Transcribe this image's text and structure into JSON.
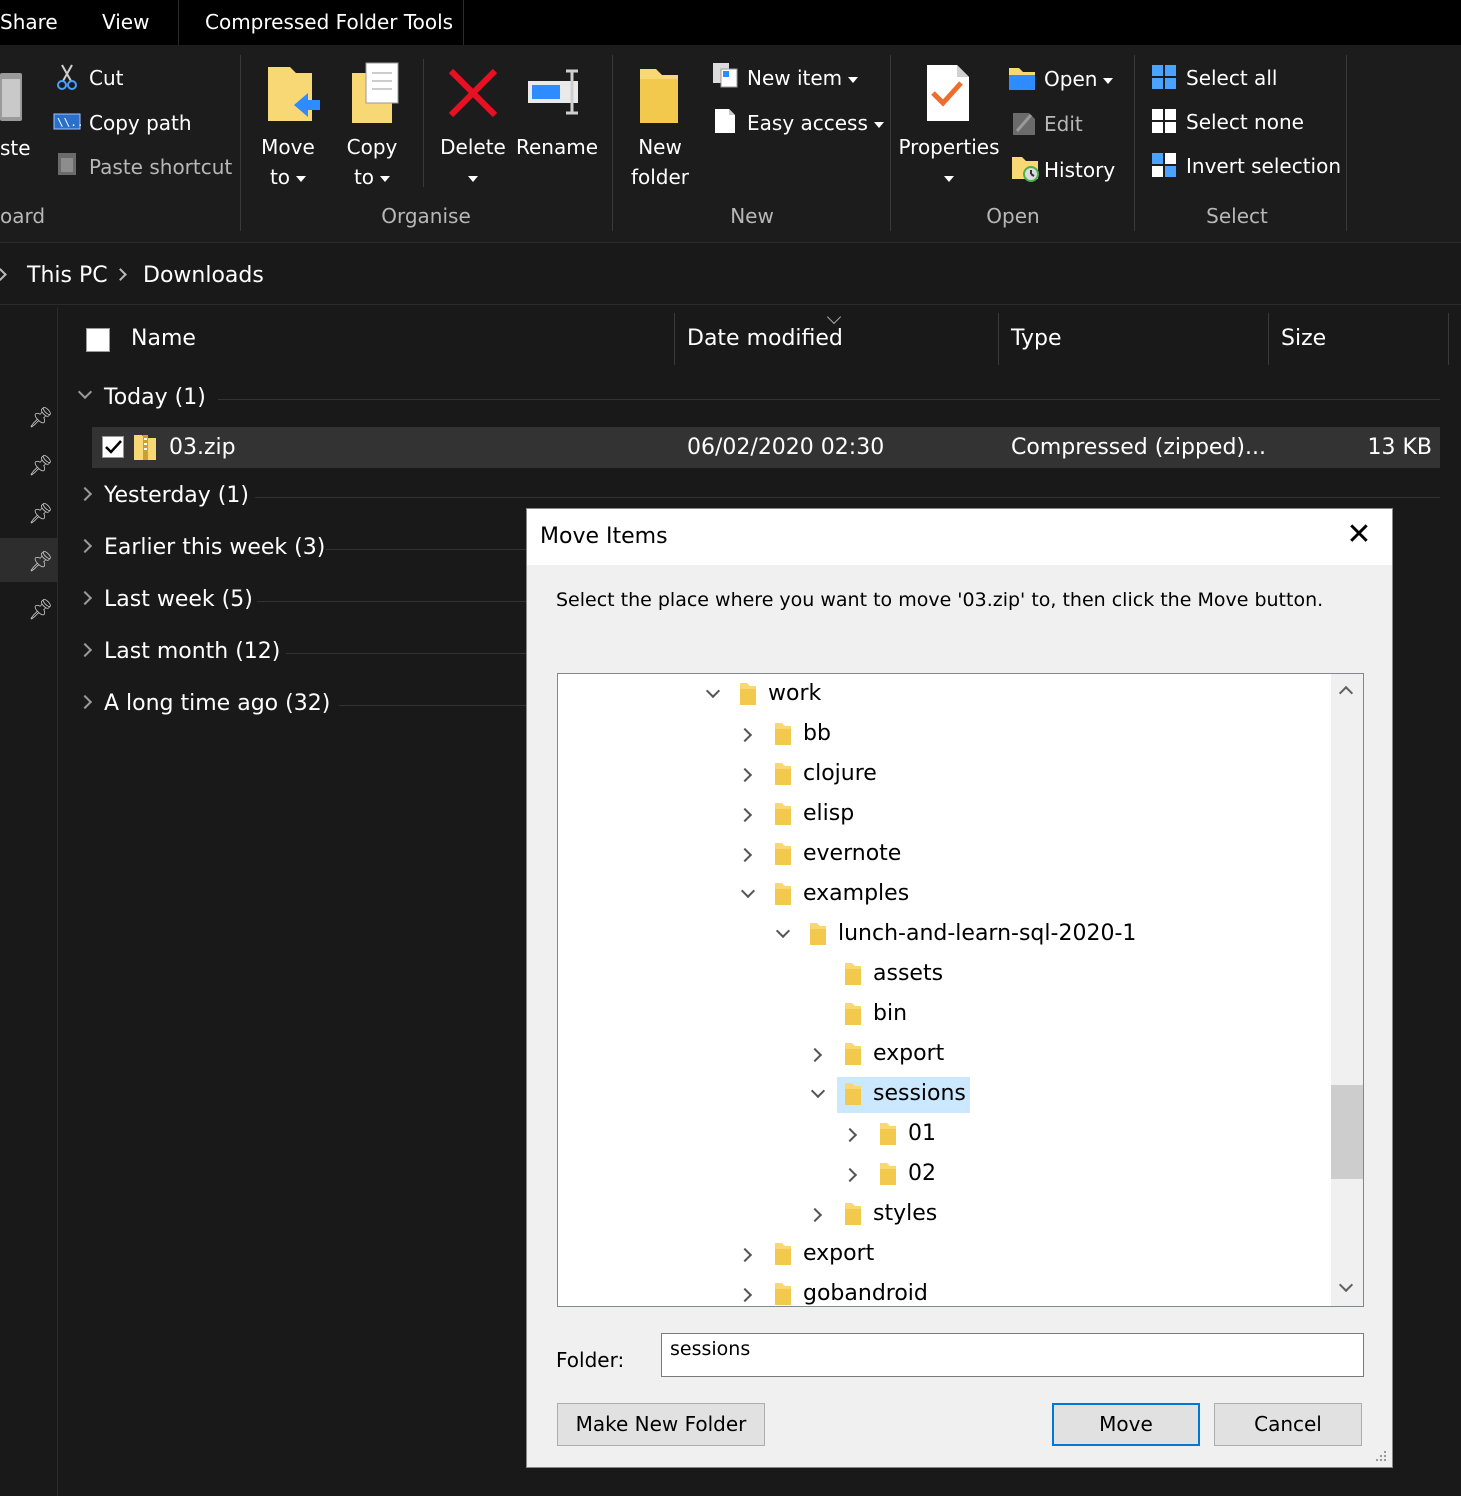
{
  "tabs": [
    "Share",
    "View",
    "Compressed Folder Tools"
  ],
  "ribbon": {
    "clipboard": {
      "paste_label": "ste",
      "cut": "Cut",
      "copy_path": "Copy path",
      "paste_shortcut": "Paste shortcut",
      "group_label": "oard"
    },
    "organise": {
      "move_to": [
        "Move",
        "to"
      ],
      "copy_to": [
        "Copy",
        "to"
      ],
      "delete": "Delete",
      "rename": "Rename",
      "group_label": "Organise"
    },
    "new": {
      "new_folder": [
        "New",
        "folder"
      ],
      "new_item": "New item",
      "easy_access": "Easy access",
      "group_label": "New"
    },
    "open": {
      "properties": "Properties",
      "open": "Open",
      "edit": "Edit",
      "history": "History",
      "group_label": "Open"
    },
    "select": {
      "select_all": "Select all",
      "select_none": "Select none",
      "invert_selection": "Invert selection",
      "group_label": "Select"
    }
  },
  "breadcrumb": [
    "This PC",
    "Downloads"
  ],
  "columns": {
    "name": "Name",
    "date_modified": "Date modified",
    "type": "Type",
    "size": "Size"
  },
  "groups": [
    {
      "label": "Today (1)",
      "expanded": true
    },
    {
      "label": "Yesterday (1)",
      "expanded": false
    },
    {
      "label": "Earlier this week (3)",
      "expanded": false
    },
    {
      "label": "Last week (5)",
      "expanded": false
    },
    {
      "label": "Last month (12)",
      "expanded": false
    },
    {
      "label": "A long time ago (32)",
      "expanded": false
    }
  ],
  "file": {
    "name": "03.zip",
    "date_modified": "06/02/2020 02:30",
    "type": "Compressed (zipped)...",
    "size": "13 KB",
    "checked": true
  },
  "dialog": {
    "title": "Move Items",
    "close_glyph": "✕",
    "instruction": "Select the place where you want to move '03.zip' to, then click the Move button.",
    "tree": [
      {
        "label": "work",
        "state": "expanded",
        "depth": 0
      },
      {
        "label": "bb",
        "state": "collapsed",
        "depth": 1
      },
      {
        "label": "clojure",
        "state": "collapsed",
        "depth": 1
      },
      {
        "label": "elisp",
        "state": "collapsed",
        "depth": 1
      },
      {
        "label": "evernote",
        "state": "collapsed",
        "depth": 1
      },
      {
        "label": "examples",
        "state": "expanded",
        "depth": 1
      },
      {
        "label": "lunch-and-learn-sql-2020-1",
        "state": "expanded",
        "depth": 2
      },
      {
        "label": "assets",
        "state": "none",
        "depth": 3
      },
      {
        "label": "bin",
        "state": "none",
        "depth": 3
      },
      {
        "label": "export",
        "state": "collapsed",
        "depth": 3
      },
      {
        "label": "sessions",
        "state": "expanded",
        "depth": 3,
        "selected": true
      },
      {
        "label": "01",
        "state": "collapsed",
        "depth": 4
      },
      {
        "label": "02",
        "state": "collapsed",
        "depth": 4
      },
      {
        "label": "styles",
        "state": "collapsed",
        "depth": 3
      },
      {
        "label": "export",
        "state": "collapsed",
        "depth": 1
      },
      {
        "label": "gobandroid",
        "state": "collapsed",
        "depth": 1
      }
    ],
    "folder_label": "Folder:",
    "folder_value": "sessions",
    "make_new_folder": "Make New Folder",
    "move": "Move",
    "cancel": "Cancel"
  },
  "colors": {
    "explorer_bg": "#191919",
    "ribbon_bg": "#1c1c1c",
    "dialog_bg": "#f0f0f0",
    "selection": "#cce8ff",
    "accent": "#0078d7",
    "folder_yellow": "#f8d775",
    "delete_red": "#e81123"
  }
}
